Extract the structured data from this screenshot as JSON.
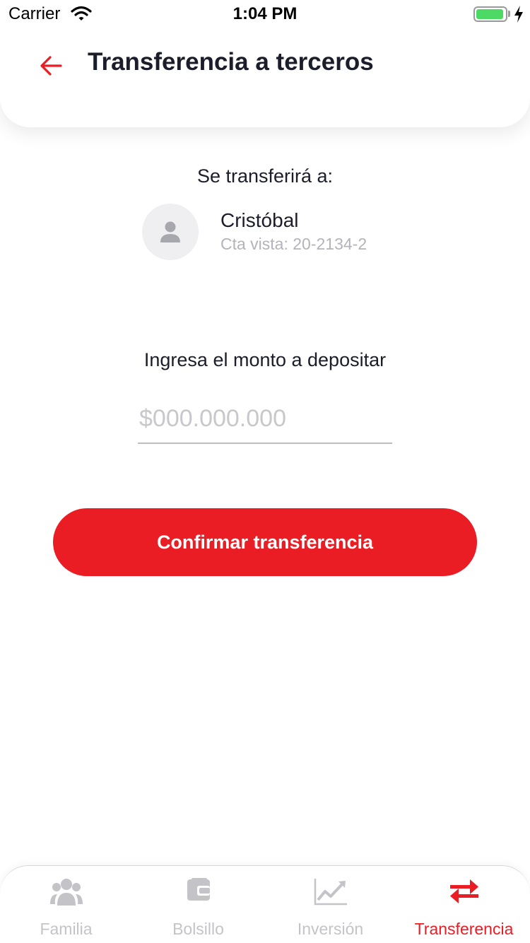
{
  "status_bar": {
    "carrier": "Carrier",
    "time": "1:04 PM"
  },
  "header": {
    "title": "Transferencia a terceros",
    "back_icon": "arrow-left-icon"
  },
  "recipient": {
    "label": "Se transferirá a:",
    "avatar_icon": "person-icon",
    "name": "Cristóbal",
    "account": "Cta vista: 20-2134-2"
  },
  "amount": {
    "label": "Ingresa el monto a depositar",
    "placeholder": "$000.000.000",
    "value": ""
  },
  "confirm_button": {
    "label": "Confirmar transferencia"
  },
  "tab_bar": {
    "items": [
      {
        "label": "Familia",
        "icon": "family-icon",
        "active": false
      },
      {
        "label": "Bolsillo",
        "icon": "wallet-icon",
        "active": false
      },
      {
        "label": "Inversión",
        "icon": "chart-line-icon",
        "active": false
      },
      {
        "label": "Transferencia",
        "icon": "transfer-arrows-icon",
        "active": true
      }
    ]
  },
  "colors": {
    "accent": "#ea1c24",
    "text": "#1c1d2a",
    "muted": "#b3b3bb",
    "inactive_tab": "#c4c4c8",
    "battery": "#4cd964"
  }
}
